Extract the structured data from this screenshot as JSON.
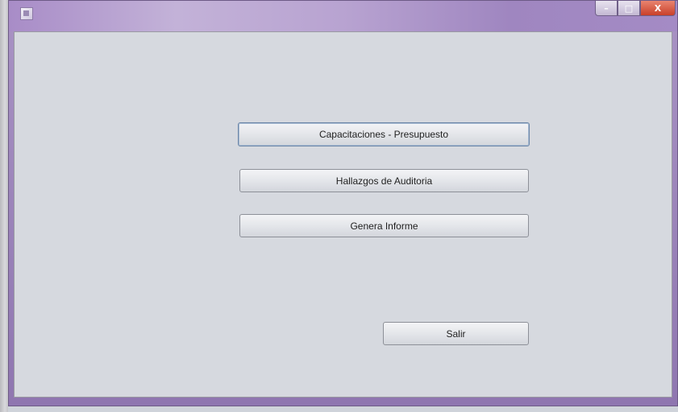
{
  "window": {
    "title": "",
    "controls": {
      "minimize_icon": "minimize-icon",
      "maximize_icon": "maximize-icon",
      "close_icon": "close-icon",
      "minimize_glyph": "–",
      "maximize_glyph": "□",
      "close_glyph": "X"
    }
  },
  "menu": {
    "capacitaciones_label": "Capacitaciones - Presupuesto",
    "hallazgos_label": "Hallazgos de Auditoria",
    "informe_label": "Genera Informe",
    "salir_label": "Salir"
  },
  "colors": {
    "titlebar": "#a88cc7",
    "background": "#d6d9df",
    "close_button": "#c9402a"
  }
}
